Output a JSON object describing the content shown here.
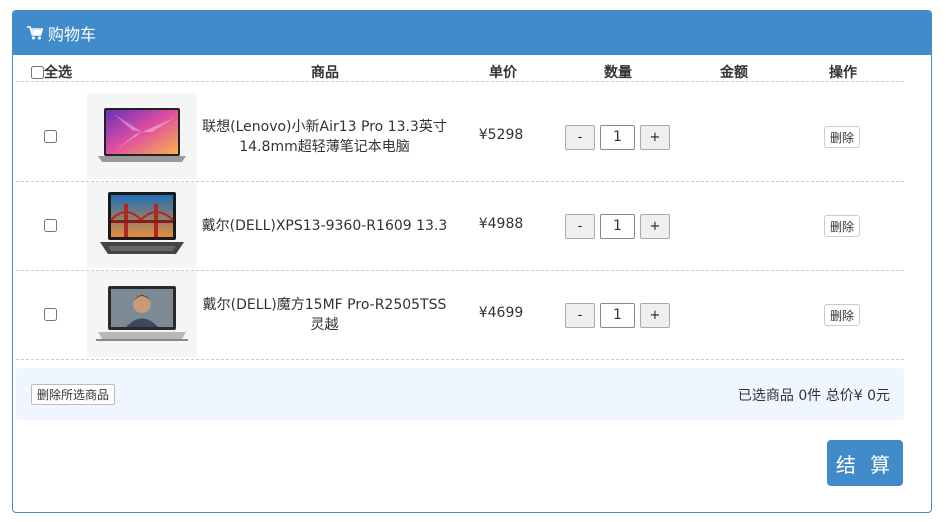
{
  "panel": {
    "title": "购物车"
  },
  "table": {
    "headers": {
      "select_all": "全选",
      "product": "商品",
      "unit_price": "单价",
      "quantity": "数量",
      "amount": "金额",
      "action": "操作"
    },
    "rows": [
      {
        "name": "联想(Lenovo)小新Air13 Pro 13.3英寸14.8mm超轻薄笔记本电脑",
        "price": "¥5298",
        "qty": "1",
        "minus": "-",
        "plus": "+",
        "delete": "删除",
        "thumb": "laptop-purple-screen"
      },
      {
        "name": "戴尔(DELL)XPS13-9360-R1609 13.3",
        "price": "¥4988",
        "qty": "1",
        "minus": "-",
        "plus": "+",
        "delete": "删除",
        "thumb": "laptop-bridge-screen"
      },
      {
        "name": "戴尔(DELL)魔方15MF Pro-R2505TSS灵越",
        "price": "¥4699",
        "qty": "1",
        "minus": "-",
        "plus": "+",
        "delete": "删除",
        "thumb": "laptop-person-screen"
      }
    ]
  },
  "footer": {
    "delete_selected": "删除所选商品",
    "summary": "已选商品 0件 总价¥ 0元"
  },
  "checkout_label": "结 算",
  "colors": {
    "primary": "#428bca",
    "footer_bg": "#f0f6ff"
  }
}
